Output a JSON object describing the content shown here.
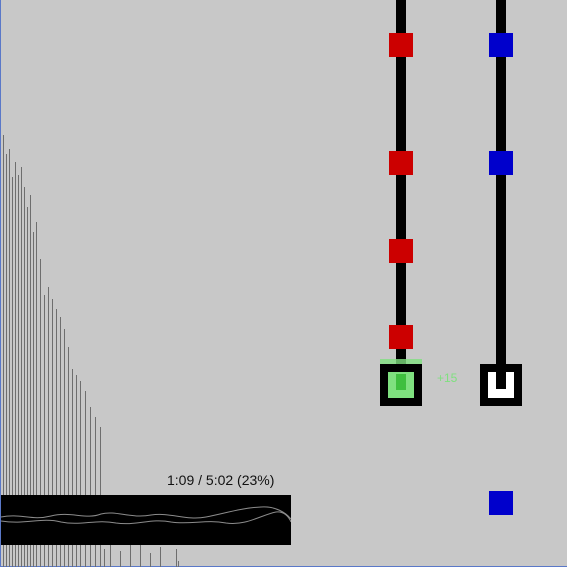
{
  "game": {
    "colors": {
      "background": "#c8c8c8",
      "red_note": "#cc0000",
      "blue_note": "#0000cc",
      "hit_green": "#7fe07f",
      "hit_green_dark": "#3fbf3f",
      "receptor": "#000000",
      "waveform_line": "#8c8c8c"
    },
    "lanes": [
      {
        "name": "red-lane",
        "note_color": "red",
        "notes_above_receptor": 4,
        "receptor_state": "hit"
      },
      {
        "name": "blue-lane",
        "note_color": "blue",
        "notes_above_receptor": 2,
        "notes_below_receptor": 1,
        "receptor_state": "idle"
      }
    ],
    "score_popup": "+15",
    "progress": {
      "label": "1:09 / 5:02 (23%)",
      "elapsed": "1:09",
      "total": "5:02",
      "percent": 23
    }
  }
}
